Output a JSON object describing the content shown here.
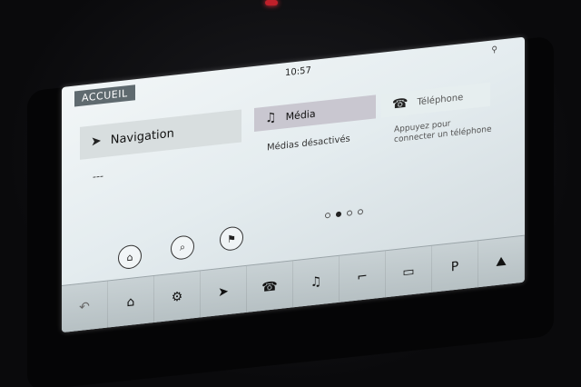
{
  "header": {
    "home_label": "ACCUEIL",
    "time": "10:57"
  },
  "tiles": {
    "navigation": {
      "label": "Navigation",
      "icon": "navigation-arrow-icon",
      "status": "---"
    },
    "media": {
      "label": "Média",
      "icon": "media-icon",
      "status": "Médias désactivés"
    },
    "phone": {
      "label": "Téléphone",
      "icon": "phone-icon",
      "status": "Appuyez pour connecter un téléphone"
    }
  },
  "quick_buttons": [
    {
      "name": "home-destination-icon",
      "glyph": "⌂"
    },
    {
      "name": "search-icon",
      "glyph": "⌕"
    },
    {
      "name": "finish-flag-icon",
      "glyph": "⚑"
    }
  ],
  "pager": {
    "count": 4,
    "active_index": 1
  },
  "shortcut_icons": [
    {
      "name": "media-shortcut-icon",
      "glyph": "♫"
    },
    {
      "name": "seat-icon",
      "glyph": "⌐"
    },
    {
      "name": "camera-icon",
      "glyph": "▭"
    },
    {
      "name": "parking-icon",
      "glyph": "P"
    },
    {
      "name": "terrain-icon",
      "glyph": "⛰"
    }
  ],
  "dock": [
    {
      "name": "back-icon",
      "glyph": "↶",
      "dim": true
    },
    {
      "name": "home-icon",
      "glyph": "⌂",
      "dim": false
    },
    {
      "name": "settings-icon",
      "glyph": "⚙",
      "dim": false
    },
    {
      "name": "navigation-icon",
      "glyph": "➤",
      "dim": false
    },
    {
      "name": "phone-icon",
      "glyph": "☎",
      "dim": false
    },
    {
      "name": "media-icon",
      "glyph": "♫",
      "dim": false
    },
    {
      "name": "seat-icon",
      "glyph": "⌐",
      "dim": false
    },
    {
      "name": "camera-icon",
      "glyph": "▭",
      "dim": false
    },
    {
      "name": "parking-icon",
      "glyph": "P",
      "dim": false
    },
    {
      "name": "terrain-icon",
      "glyph": "⛰",
      "dim": false
    }
  ],
  "colors": {
    "header_badge": "#5f6a6f",
    "media_tile": "#c9c7d0",
    "screen_bg": "#e4ecef"
  }
}
